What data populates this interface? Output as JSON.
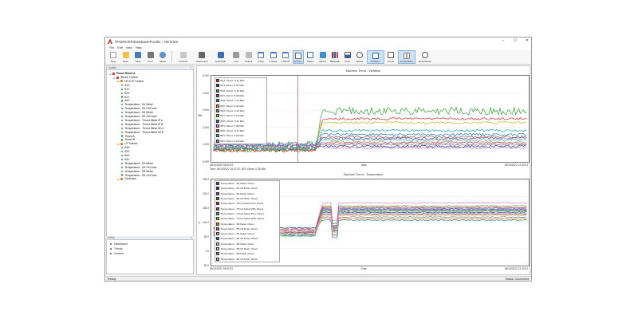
{
  "window": {
    "title": "\\\\PSERVER\\Database\\Prod01 - AlertView",
    "controls": [
      "–",
      "☐",
      "✕"
    ]
  },
  "menu": [
    "File",
    "Edit",
    "View",
    "Help"
  ],
  "toolbar": [
    {
      "label": "New",
      "icon": "new-icon"
    },
    {
      "label": "Open",
      "icon": "open-icon"
    },
    {
      "label": "Save",
      "icon": "save-icon"
    },
    {
      "label": "Print",
      "icon": "print-icon"
    },
    {
      "label": "About",
      "icon": "about-icon"
    },
    {
      "label": "Connect",
      "icon": "connect-icon"
    },
    {
      "label": "Disconnect",
      "icon": "disconnect-icon"
    },
    {
      "label": "Autoscale",
      "icon": "autoscale-icon"
    },
    {
      "label": "Lock",
      "icon": "lock-icon"
    },
    {
      "label": "Unlock",
      "icon": "unlock-icon"
    },
    {
      "label": "1 Day",
      "icon": "day-icon"
    },
    {
      "label": "1 Week",
      "icon": "week-icon"
    },
    {
      "label": "1 Month",
      "icon": "month-icon"
    },
    {
      "label": "Cyclone",
      "icon": "cyclone-icon",
      "active": true
    },
    {
      "label": "Tables",
      "icon": "tables-icon"
    },
    {
      "label": "Alarms",
      "icon": "alarms-icon"
    },
    {
      "label": "Bargraph",
      "icon": "bargraph-icon"
    },
    {
      "label": "Level",
      "icon": "level-icon"
    },
    {
      "label": "Speed",
      "icon": "speed-icon"
    },
    {
      "label": "Vibration",
      "icon": "vibration-icon",
      "active": true
    },
    {
      "label": "Thrust",
      "icon": "thrust-icon"
    },
    {
      "label": "Temperature",
      "icon": "temperature-icon",
      "active": true
    },
    {
      "label": "Eccentricity",
      "icon": "eccentricity-icon"
    }
  ],
  "left_pane": {
    "header": "Assets",
    "tree": [
      {
        "label": "Power Block A",
        "level": 0,
        "type": "red",
        "bold": true
      },
      {
        "label": "Steam Turbine",
        "level": 1,
        "type": "red"
      },
      {
        "label": "HP & IP Turbine",
        "level": 2,
        "type": "orange"
      },
      {
        "label": "B1X",
        "level": 3,
        "type": "green"
      },
      {
        "label": "B1Y",
        "level": 3,
        "type": "green"
      },
      {
        "label": "B2X",
        "level": 3,
        "type": "green"
      },
      {
        "label": "B2Y",
        "level": 3,
        "type": "green"
      },
      {
        "label": "B2C",
        "level": 3,
        "type": "green"
      },
      {
        "label": "Temperature - B1 Metal",
        "level": 3,
        "type": "green"
      },
      {
        "label": "Temperature - B1 Oil Drain",
        "level": 3,
        "type": "green"
      },
      {
        "label": "Temperature - B2 Metal",
        "level": 3,
        "type": "green"
      },
      {
        "label": "Temperature - B2 Oil Drain",
        "level": 3,
        "type": "green"
      },
      {
        "label": "Temperature - Thrust Metal IP A",
        "level": 3,
        "type": "green"
      },
      {
        "label": "Temperature - Thrust Metal IP B",
        "level": 3,
        "type": "green"
      },
      {
        "label": "Temperature - Thrust Metal IM A",
        "level": 3,
        "type": "green"
      },
      {
        "label": "Temperature - Thrust Metal IM B",
        "level": 3,
        "type": "green"
      },
      {
        "label": "Thrust A",
        "level": 3,
        "type": "green"
      },
      {
        "label": "Thrust B",
        "level": 3,
        "type": "green"
      },
      {
        "label": "LP Turbine",
        "level": 2,
        "type": "orange"
      },
      {
        "label": "B3X",
        "level": 3,
        "type": "green"
      },
      {
        "label": "B3Y",
        "level": 3,
        "type": "green"
      },
      {
        "label": "B4X",
        "level": 3,
        "type": "green"
      },
      {
        "label": "B4Y",
        "level": 3,
        "type": "green"
      },
      {
        "label": "Temperature - B3 Metal",
        "level": 3,
        "type": "green"
      },
      {
        "label": "Temperature - B3 Oil Drain",
        "level": 3,
        "type": "green"
      },
      {
        "label": "Temperature - B4 Metal",
        "level": 3,
        "type": "green"
      },
      {
        "label": "Temperature - B4 Oil Drain",
        "level": 3,
        "type": "green"
      },
      {
        "label": "Generator",
        "level": 2,
        "type": "orange"
      }
    ]
  },
  "views_pane": {
    "header": "Views",
    "items": [
      "Dashboard",
      "Trends",
      "Custom"
    ]
  },
  "vibration_chart": {
    "title": "Machine Trend - Vibration",
    "y_ticks": [
      "5.000",
      "4.000",
      "3.000",
      "2.000",
      "1.000",
      "0.000"
    ],
    "y_unit": "Mils",
    "x_start": "06/15/2022 06:50:51",
    "x_mid": "Date",
    "x_end": "06/16/2022 12:42:01",
    "cursor_text": "Time: 06/15/2022 10:07:00, B2Y, Direct: 0.38 Mils",
    "legend": [
      {
        "label": "B1X, Direct: 0.32 Mils",
        "color": "#d62728"
      },
      {
        "label": "B1Y, Direct: 0.24 Mils",
        "color": "#1f2f8a"
      },
      {
        "label": "B2X, Direct: 0.18 Mils",
        "color": "#2ca02c"
      },
      {
        "label": "B2Y, Direct: 0.38 Mils",
        "color": "#8c3a9c"
      },
      {
        "label": "B3X, Direct: 0.12 Mils",
        "color": "#17a2b8"
      },
      {
        "label": "B3Y, Direct: 0.42 Mils",
        "color": "#ff7f0e"
      },
      {
        "label": "B4X, Direct: 0.18 Mils",
        "color": "#7f7f7f"
      },
      {
        "label": "B4Y, Direct: 0.16 Mils",
        "color": "#bcbd22"
      },
      {
        "label": "B5X, Direct: 0.42 Mils",
        "color": "#1f77b4"
      },
      {
        "label": "B5Y, Direct: 0.38 Mils",
        "color": "#e377c2"
      },
      {
        "label": "B6X, Direct: 0.33 Mils",
        "color": "#8c564b"
      },
      {
        "label": "B6Y, Direct: 0.26 Mils",
        "color": "#17becf"
      },
      {
        "label": "B6Y, Direct: 0.26 Mils",
        "color": "#9467bd"
      }
    ]
  },
  "temperature_chart": {
    "title": "Machine Trend - Temperature",
    "y_ticks": [
      "250.0",
      "200.0",
      "150.0",
      "100.0",
      "50.0",
      "0.0",
      "-50.0"
    ],
    "y_unit": "°F",
    "x_start": "06/15/2022 06:50:51",
    "x_mid": "Date",
    "x_end": "06/16/2022 12:42:01",
    "legend": [
      {
        "label": "Temperature - B1 Metal, Direct",
        "color": "#2b66b1"
      },
      {
        "label": "Temperature - B1 Oil Drain, Direct",
        "color": "#1f2f8a"
      },
      {
        "label": "Temperature - B2 Metal, Direct",
        "color": "#6a3d9a"
      },
      {
        "label": "Temperature - B2 Oil Drain, Direct",
        "color": "#2ca02c"
      },
      {
        "label": "Temperature - Thrust Metal P1A, Direct",
        "color": "#d62728"
      },
      {
        "label": "Temperature - Thrust Metal P1B, Direct",
        "color": "#8c564b"
      },
      {
        "label": "Temperature - Thrust Metal IM A, Direct",
        "color": "#17a2b8"
      },
      {
        "label": "Temperature - Thrust Metal IM B, Direct",
        "color": "#bcbd22"
      },
      {
        "label": "Temperature - B3 Metal, Direct",
        "color": "#ff7f0e"
      },
      {
        "label": "Temperature - B3 Oil Drain, Direct",
        "color": "#7f7f7f"
      },
      {
        "label": "Temperature - B4 Metal, Direct",
        "color": "#e377c2"
      },
      {
        "label": "Temperature - B4 Oil Drain, Direct",
        "color": "#1f77b4"
      },
      {
        "label": "Temperature - B5 Metal, Direct",
        "color": "#98df8a"
      },
      {
        "label": "Temperature - B5 Oil Drain, Direct",
        "color": "#c5b0d5"
      },
      {
        "label": "Temperature - B6 Metal, Direct",
        "color": "#9467bd"
      },
      {
        "label": "Temperature - B6 Oil Drain, Direct",
        "color": "#ff9896"
      }
    ]
  },
  "status": {
    "left": "Ready",
    "right": "Status: Connected"
  }
}
